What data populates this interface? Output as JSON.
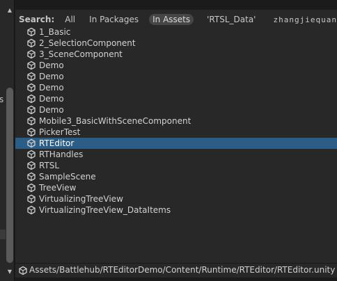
{
  "search": {
    "label": "Search:",
    "chips": [
      "All",
      "In Packages",
      "In Assets",
      "'RTSL_Data'"
    ],
    "active_chip": "In Assets",
    "user": "zhangjiequan"
  },
  "left_pane": {
    "edge_text": "s"
  },
  "items": [
    {
      "name": "1_Basic",
      "icon": "unity-scene-icon"
    },
    {
      "name": "2_SelectionComponent",
      "icon": "unity-scene-icon"
    },
    {
      "name": "3_SceneComponent",
      "icon": "unity-scene-icon"
    },
    {
      "name": "Demo",
      "icon": "unity-scene-icon"
    },
    {
      "name": "Demo",
      "icon": "unity-scene-icon"
    },
    {
      "name": "Demo",
      "icon": "unity-scene-icon"
    },
    {
      "name": "Demo",
      "icon": "unity-scene-icon"
    },
    {
      "name": "Demo",
      "icon": "unity-scene-icon"
    },
    {
      "name": "Mobile3_BasicWithSceneComponent",
      "icon": "unity-scene-icon"
    },
    {
      "name": "PickerTest",
      "icon": "unity-scene-icon"
    },
    {
      "name": "RTEditor",
      "icon": "unity-scene-icon",
      "selected": true
    },
    {
      "name": "RTHandles",
      "icon": "unity-scene-icon"
    },
    {
      "name": "RTSL",
      "icon": "unity-scene-icon"
    },
    {
      "name": "SampleScene",
      "icon": "unity-scene-icon"
    },
    {
      "name": "TreeView",
      "icon": "unity-scene-icon"
    },
    {
      "name": "VirtualizingTreeView",
      "icon": "unity-scene-icon"
    },
    {
      "name": "VirtualizingTreeView_DataItems",
      "icon": "unity-scene-icon"
    }
  ],
  "status": {
    "path": "Assets/Battlehub/RTEditorDemo/Content/Runtime/RTEditor/RTEditor.unity",
    "icon": "unity-scene-icon"
  },
  "colors": {
    "selection": "#2c5d87",
    "panel": "#282828",
    "active_chip": "#464646"
  }
}
